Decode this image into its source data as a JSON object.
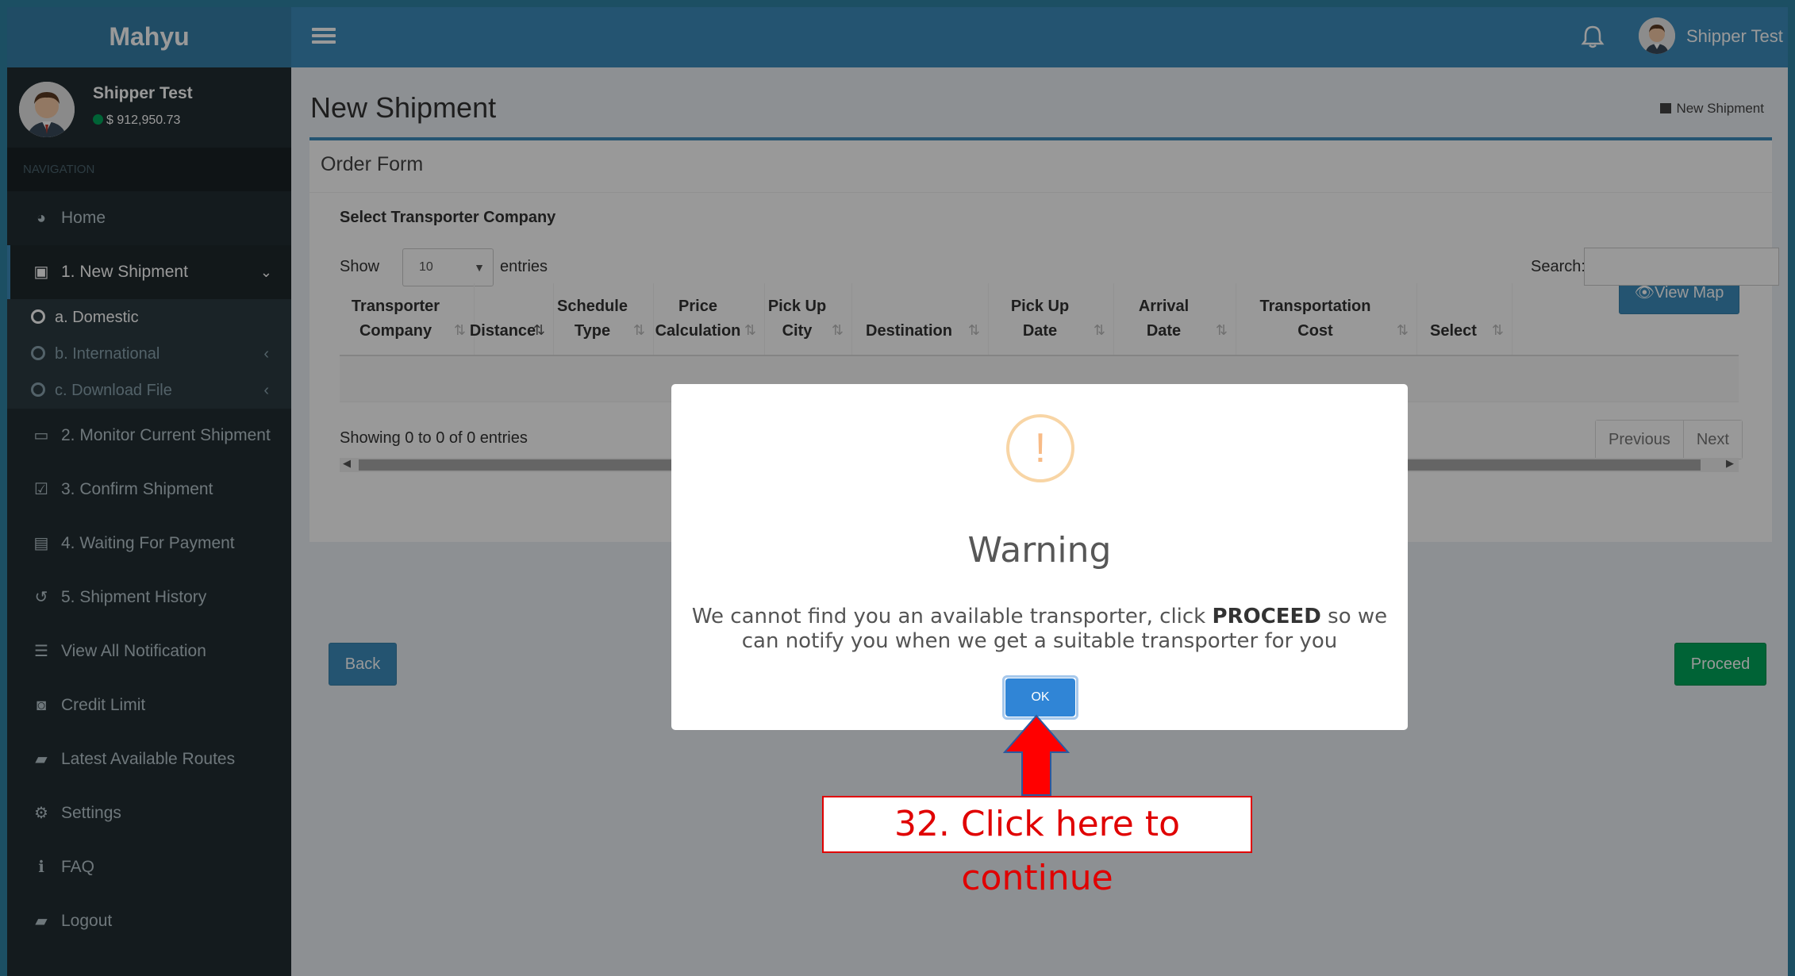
{
  "app": {
    "logo": "Mahyu"
  },
  "navbar": {
    "user_name": "Shipper Test"
  },
  "sidebar": {
    "user_name": "Shipper Test",
    "balance": "$ 912,950.73",
    "nav_header": "NAVIGATION",
    "items": [
      {
        "label": "Home",
        "icon": "dashboard-icon"
      },
      {
        "label": "1. New Shipment",
        "icon": "box-icon"
      },
      {
        "label": "2. Monitor Current Shipment",
        "icon": "laptop-icon"
      },
      {
        "label": "3. Confirm Shipment",
        "icon": "check-square-icon"
      },
      {
        "label": "4. Waiting For Payment",
        "icon": "credit-card-icon"
      },
      {
        "label": "5. Shipment History",
        "icon": "history-icon"
      },
      {
        "label": "View All Notification",
        "icon": "list-icon"
      },
      {
        "label": "Credit Limit",
        "icon": "money-icon"
      },
      {
        "label": "Latest Available Routes",
        "icon": "book-icon"
      },
      {
        "label": "Settings",
        "icon": "gear-icon"
      },
      {
        "label": "FAQ",
        "icon": "info-icon"
      },
      {
        "label": "Logout",
        "icon": "book-icon"
      }
    ],
    "submenu": [
      {
        "label": "a. Domestic"
      },
      {
        "label": "b. International"
      },
      {
        "label": "c. Download File"
      }
    ]
  },
  "page": {
    "title": "New Shipment",
    "breadcrumb": "New Shipment"
  },
  "form": {
    "box_title": "Order Form",
    "section_title": "Select Transporter Company",
    "view_map": "View Map",
    "show_label": "Show",
    "show_value": "10",
    "entries_label": "entries",
    "search_label": "Search:",
    "search_value": "",
    "info": "Showing 0 to 0 of 0 entries",
    "prev": "Previous",
    "next": "Next",
    "back": "Back",
    "proceed": "Proceed"
  },
  "table": {
    "columns": [
      {
        "l1": "Transporter",
        "l2": "Company"
      },
      {
        "l1": "",
        "l2": "Distance"
      },
      {
        "l1": "Schedule",
        "l2": "Type"
      },
      {
        "l1": "Price",
        "l2": "Calculation"
      },
      {
        "l1": "Pick Up",
        "l2": "City"
      },
      {
        "l1": "",
        "l2": "Destination"
      },
      {
        "l1": "Pick Up",
        "l2": "Date"
      },
      {
        "l1": "Arrival",
        "l2": "Date"
      },
      {
        "l1": "Transportation",
        "l2": "Cost"
      },
      {
        "l1": "",
        "l2": "Select"
      }
    ]
  },
  "modal": {
    "icon": "!",
    "title": "Warning",
    "text_before": "We cannot find you an available transporter, click ",
    "text_bold": "PROCEED",
    "text_after": " so we can notify you when we get a suitable transporter for you",
    "ok": "OK"
  },
  "annotation": {
    "text": "32. Click here to continue",
    "color": "#e00000"
  },
  "colors": {
    "primary": "#3c8dbc",
    "sidebar": "#222d32",
    "success": "#00a65a",
    "warning": "#f8bb86",
    "modal_button": "#3085d6"
  }
}
